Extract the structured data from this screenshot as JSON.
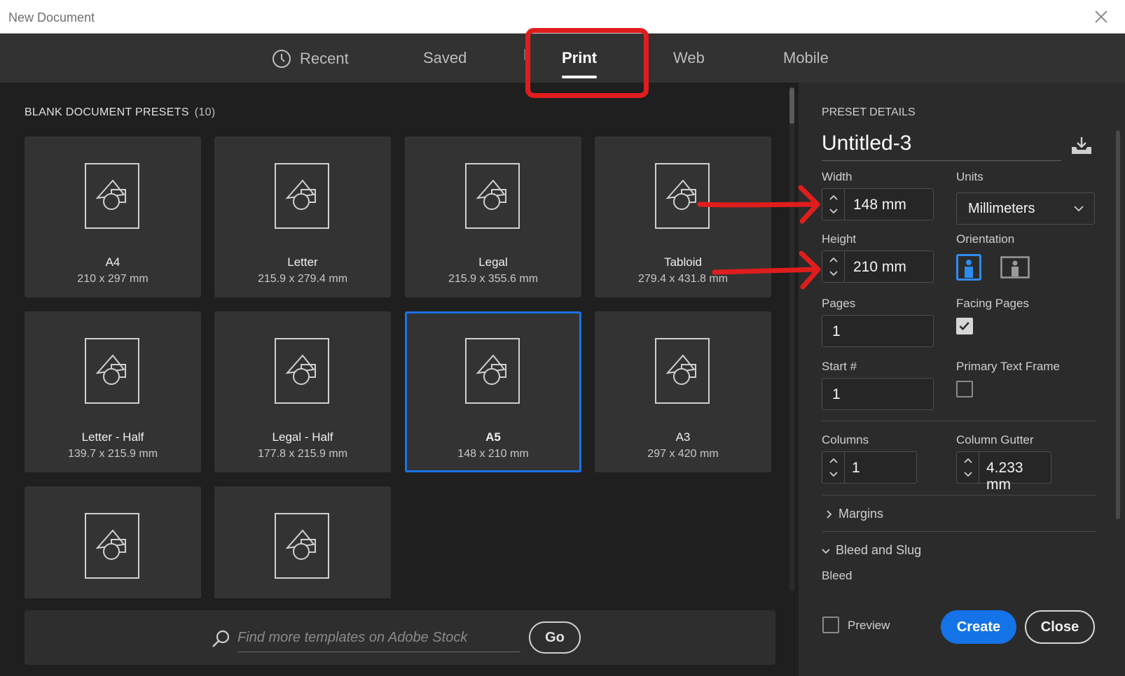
{
  "window": {
    "title": "New Document"
  },
  "tabs": [
    {
      "label": "Recent",
      "icon": "clock-icon"
    },
    {
      "label": "Saved"
    },
    {
      "label": "Print",
      "active": true
    },
    {
      "label": "Web"
    },
    {
      "label": "Mobile"
    }
  ],
  "presets": {
    "section_title": "BLANK DOCUMENT PRESETS",
    "count": "(10)",
    "items": [
      {
        "name": "A4",
        "size": "210 x 297 mm"
      },
      {
        "name": "Letter",
        "size": "215.9 x 279.4 mm"
      },
      {
        "name": "Legal",
        "size": "215.9 x 355.6 mm"
      },
      {
        "name": "Tabloid",
        "size": "279.4 x 431.8 mm"
      },
      {
        "name": "Letter - Half",
        "size": "139.7 x 215.9 mm"
      },
      {
        "name": "Legal - Half",
        "size": "177.8 x 215.9 mm"
      },
      {
        "name": "A5",
        "size": "148 x 210 mm",
        "selected": true
      },
      {
        "name": "A3",
        "size": "297 x 420 mm"
      },
      {
        "name": "",
        "size": ""
      },
      {
        "name": "",
        "size": ""
      }
    ]
  },
  "search": {
    "placeholder": "Find more templates on Adobe Stock",
    "go_label": "Go"
  },
  "details": {
    "section_title": "PRESET DETAILS",
    "doc_name": "Untitled-3",
    "width_label": "Width",
    "width_value": "148 mm",
    "units_label": "Units",
    "units_value": "Millimeters",
    "height_label": "Height",
    "height_value": "210 mm",
    "orientation_label": "Orientation",
    "orientation_selected": "portrait",
    "pages_label": "Pages",
    "pages_value": "1",
    "facing_label": "Facing Pages",
    "facing_checked": true,
    "start_label": "Start #",
    "start_value": "1",
    "primary_label": "Primary Text Frame",
    "primary_checked": false,
    "columns_label": "Columns",
    "columns_value": "1",
    "gutter_label": "Column Gutter",
    "gutter_value": "4.233 mm",
    "margins_label": "Margins",
    "bleed_slug_label": "Bleed and Slug",
    "bleed_label": "Bleed",
    "preview_label": "Preview",
    "preview_checked": false,
    "create_label": "Create",
    "close_label": "Close"
  },
  "colors": {
    "accent": "#1473e6",
    "selected_border": "#1a73e8",
    "annotation": "#e01d1d"
  }
}
